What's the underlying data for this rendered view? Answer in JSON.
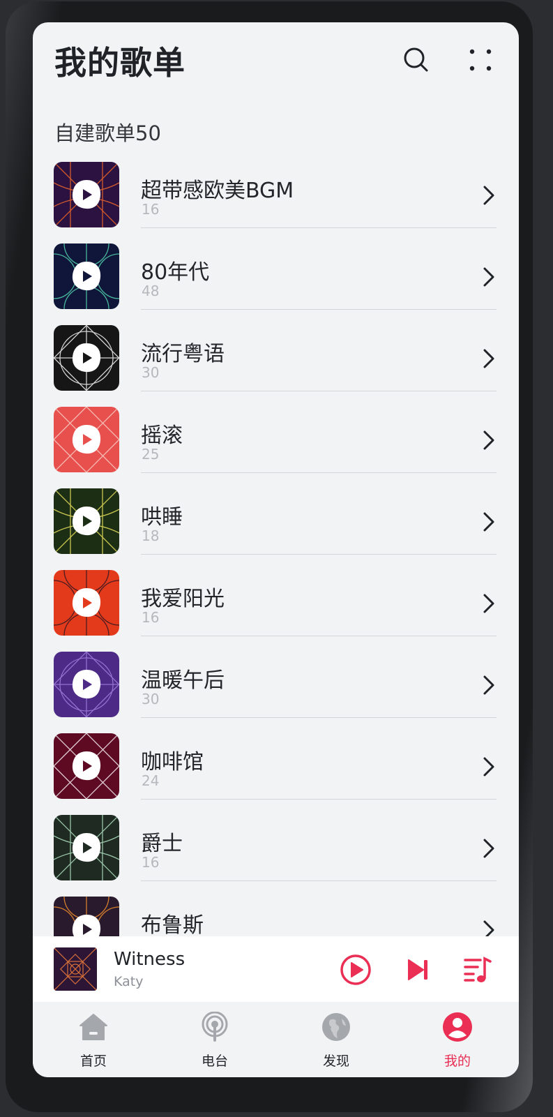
{
  "header": {
    "title": "我的歌单",
    "search_icon": "search-icon",
    "more_icon": "more-dots-icon"
  },
  "section": {
    "label": "自建歌单50"
  },
  "playlists": [
    {
      "name": "超带感欧美BGM",
      "count": "16",
      "bg": "#2b1240",
      "line": "#e8642d"
    },
    {
      "name": "80年代",
      "count": "48",
      "bg": "#10163a",
      "line": "#4fc8a8"
    },
    {
      "name": "流行粤语",
      "count": "30",
      "bg": "#161616",
      "line": "#e8e8e8"
    },
    {
      "name": "摇滚",
      "count": "25",
      "bg": "#e8504e",
      "line": "#f7c9c0"
    },
    {
      "name": "哄睡",
      "count": "18",
      "bg": "#1c2f14",
      "line": "#e1d95a"
    },
    {
      "name": "我爱阳光",
      "count": "16",
      "bg": "#e33a1c",
      "line": "#3a1a22"
    },
    {
      "name": "温暖午后",
      "count": "30",
      "bg": "#4d2a86",
      "line": "#9b7bd8"
    },
    {
      "name": "咖啡馆",
      "count": "24",
      "bg": "#5e0a22",
      "line": "#f0e6ea"
    },
    {
      "name": "爵士",
      "count": "16",
      "bg": "#1e2a22",
      "line": "#a8d8b8"
    },
    {
      "name": "布鲁斯",
      "count": "",
      "bg": "#2a1a2e",
      "line": "#e8892d"
    }
  ],
  "mini_player": {
    "title": "Witness",
    "artist": "Katy",
    "accent": "#ea2e54",
    "play_icon": "play-circle-icon",
    "next_icon": "skip-next-icon",
    "queue_icon": "playlist-queue-icon"
  },
  "tabs": [
    {
      "label": "首页",
      "icon": "home-icon",
      "active": false
    },
    {
      "label": "电台",
      "icon": "radio-icon",
      "active": false
    },
    {
      "label": "发现",
      "icon": "globe-icon",
      "active": false
    },
    {
      "label": "我的",
      "icon": "user-icon",
      "active": true
    }
  ],
  "colors": {
    "accent": "#ea2e54",
    "background": "#f1f3f5",
    "text": "#22252a",
    "muted": "#b5b8bd"
  }
}
